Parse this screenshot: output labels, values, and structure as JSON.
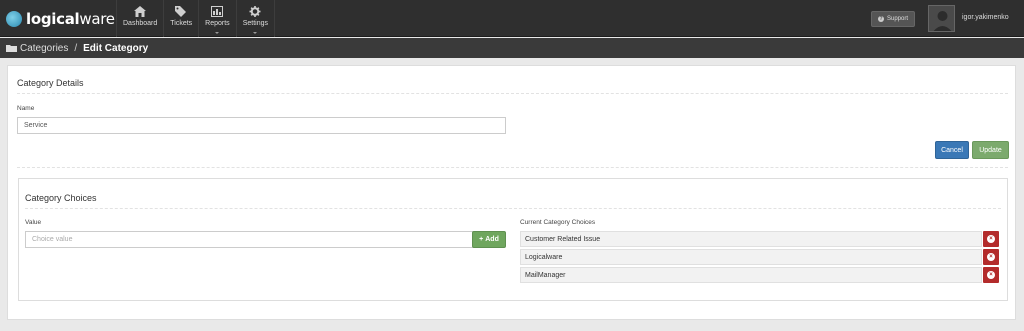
{
  "brand": {
    "logo_bold": "logical",
    "logo_light": "ware"
  },
  "nav": {
    "items": [
      {
        "label": "Dashboard",
        "icon": "home-icon"
      },
      {
        "label": "Tickets",
        "icon": "tags-icon"
      },
      {
        "label": "Reports",
        "icon": "bar-chart-icon"
      },
      {
        "label": "Settings",
        "icon": "gear-icon"
      }
    ]
  },
  "header": {
    "support_label": "Support",
    "username": "igor.yakimenko"
  },
  "breadcrumb": {
    "parent": "Categories",
    "separator": "/",
    "current": "Edit Category"
  },
  "details": {
    "title": "Category Details",
    "name_label": "Name",
    "name_value": "Service",
    "cancel_label": "Cancel",
    "update_label": "Update"
  },
  "choices": {
    "title": "Category Choices",
    "value_label": "Value",
    "value_placeholder": "Choice value",
    "add_label": "Add",
    "current_label": "Current Category Choices",
    "items": [
      "Customer Related Issue",
      "Logicalware",
      "MailManager"
    ]
  },
  "colors": {
    "primary": "#3a78b6",
    "success": "#6fa65e",
    "danger": "#b32b2b",
    "topbar": "#2f2f2f"
  }
}
